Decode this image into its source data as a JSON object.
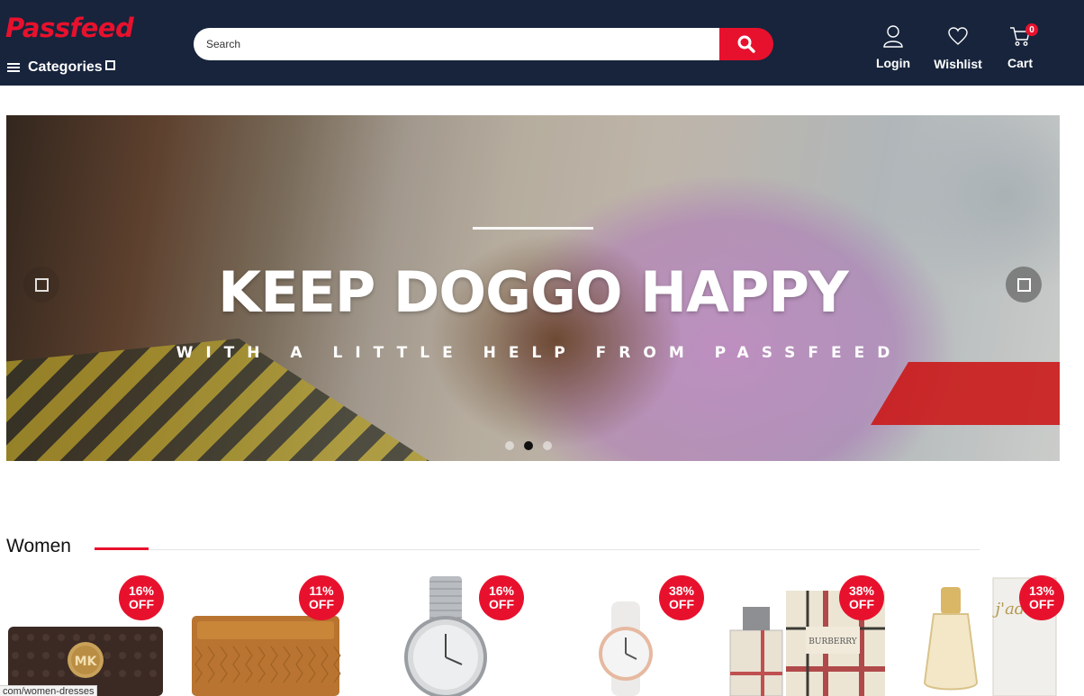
{
  "header": {
    "logo_text": "Passfeed",
    "categories_label": "Categories",
    "search": {
      "placeholder": "Search"
    },
    "login_label": "Login",
    "wishlist_label": "Wishlist",
    "cart_label": "Cart",
    "cart_count": "0"
  },
  "hero": {
    "title": "KEEP DOGGO HAPPY",
    "subtitle": "WITH A LITTLE HELP FROM PASSFEED",
    "slide_count": 3,
    "active_slide": 1
  },
  "section": {
    "title": "Women"
  },
  "products": [
    {
      "discount": "16%",
      "off_label": "OFF",
      "icon": "monogram-wallet"
    },
    {
      "discount": "11%",
      "off_label": "OFF",
      "icon": "leather-card-holder"
    },
    {
      "discount": "16%",
      "off_label": "OFF",
      "icon": "silver-wristwatch"
    },
    {
      "discount": "38%",
      "off_label": "OFF",
      "icon": "white-wristwatch"
    },
    {
      "discount": "38%",
      "off_label": "OFF",
      "icon": "perfume-bottle-with-box"
    },
    {
      "discount": "13%",
      "off_label": "OFF",
      "icon": "perfume-bottle-with-box"
    }
  ],
  "status_url": "com/women-dresses",
  "colors": {
    "brand_red": "#e8112d",
    "header_navy": "#17243c"
  }
}
